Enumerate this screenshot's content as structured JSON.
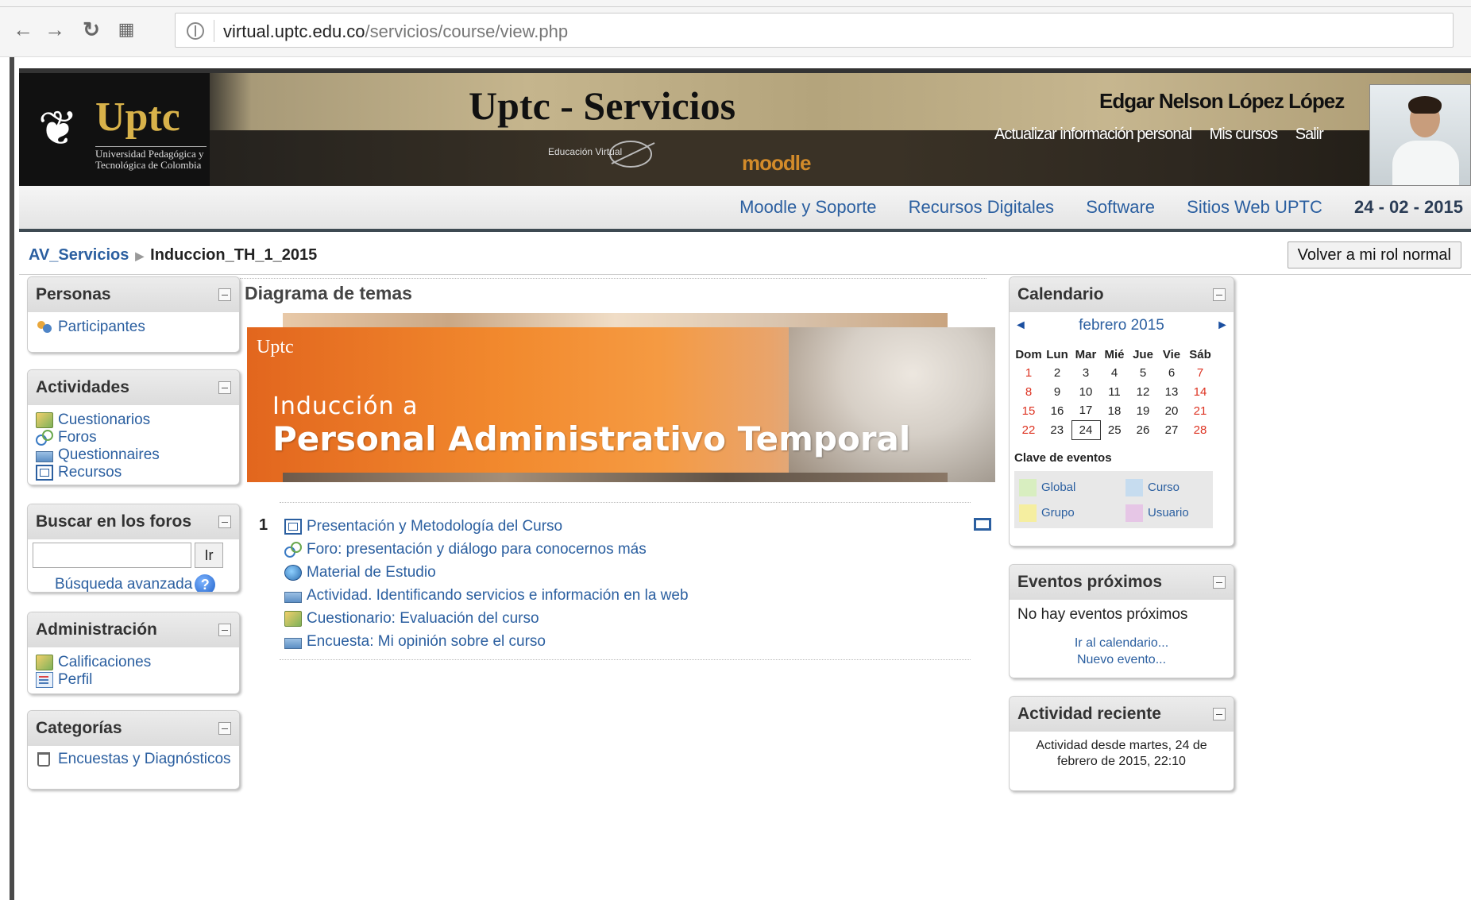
{
  "browser": {
    "url_domain": "virtual.uptc.edu.co",
    "url_path": "/servicios/course/view.php"
  },
  "header": {
    "logo_title": "Uptc",
    "logo_subtitle": "Universidad Pedagógica y Tecnológica de Colombia",
    "site_title": "Uptc - Servicios",
    "ev_logo": "Educación Virtual",
    "moodle_logo": "moodle",
    "user_name": "Edgar Nelson López López",
    "links": [
      "Actualizar información personal",
      "Mis cursos",
      "Salir"
    ]
  },
  "navbar": {
    "links": [
      "Moodle y Soporte",
      "Recursos Digitales",
      "Software",
      "Sitios Web UPTC"
    ],
    "date": "24 - 02 - 2015"
  },
  "breadcrumb": {
    "home": "AV_Servicios",
    "current": "Induccion_TH_1_2015",
    "role_button": "Volver a mi rol normal"
  },
  "left": {
    "personas": {
      "title": "Personas",
      "items": [
        "Participantes"
      ]
    },
    "actividades": {
      "title": "Actividades",
      "items": [
        "Cuestionarios",
        "Foros",
        "Questionnaires",
        "Recursos"
      ]
    },
    "buscar": {
      "title": "Buscar en los foros",
      "button": "Ir",
      "advanced": "Búsqueda avanzada",
      "help": "?"
    },
    "admin": {
      "title": "Administración",
      "items": [
        "Calificaciones",
        "Perfil"
      ]
    },
    "categorias": {
      "title": "Categorías",
      "items": [
        "Encuestas y Diagnósticos"
      ]
    }
  },
  "center": {
    "title": "Diagrama de temas",
    "banner": {
      "logo": "Uptc",
      "line1": "Inducción a",
      "line2": "Personal Administrativo Temporal"
    },
    "section_number": "1",
    "topics": [
      {
        "label": "Presentación y Metodología del Curso",
        "icon": "resource"
      },
      {
        "label": "Foro: presentación y diálogo para conocernos más",
        "icon": "forum"
      },
      {
        "label": "Material de Estudio",
        "icon": "globe"
      },
      {
        "label": "Actividad. Identificando servicios e información en la web",
        "icon": "qnr"
      },
      {
        "label": "Cuestionario: Evaluación del curso",
        "icon": "quiz"
      },
      {
        "label": "Encuesta: Mi opinión sobre el curso",
        "icon": "qnr"
      }
    ]
  },
  "right": {
    "calendar": {
      "title": "Calendario",
      "month": "febrero 2015",
      "prev": "◄",
      "next": "►",
      "weekdays": [
        "Dom",
        "Lun",
        "Mar",
        "Mié",
        "Jue",
        "Vie",
        "Sáb"
      ],
      "weeks": [
        [
          "1",
          "2",
          "3",
          "4",
          "5",
          "6",
          "7"
        ],
        [
          "8",
          "9",
          "10",
          "11",
          "12",
          "13",
          "14"
        ],
        [
          "15",
          "16",
          "17",
          "18",
          "19",
          "20",
          "21"
        ],
        [
          "22",
          "23",
          "24",
          "25",
          "26",
          "27",
          "28"
        ]
      ],
      "today": "24",
      "key_title": "Clave de eventos",
      "keys": [
        {
          "label": "Global",
          "color": "#d8eec0"
        },
        {
          "label": "Curso",
          "color": "#c6dcef"
        },
        {
          "label": "Grupo",
          "color": "#f5eea0"
        },
        {
          "label": "Usuario",
          "color": "#e6c6e6"
        }
      ]
    },
    "events": {
      "title": "Eventos próximos",
      "text": "No hay eventos próximos",
      "link1": "Ir al calendario...",
      "link2": "Nuevo evento..."
    },
    "recent": {
      "title": "Actividad reciente",
      "text": "Actividad desde martes, 24 de febrero de 2015, 22:10"
    }
  }
}
